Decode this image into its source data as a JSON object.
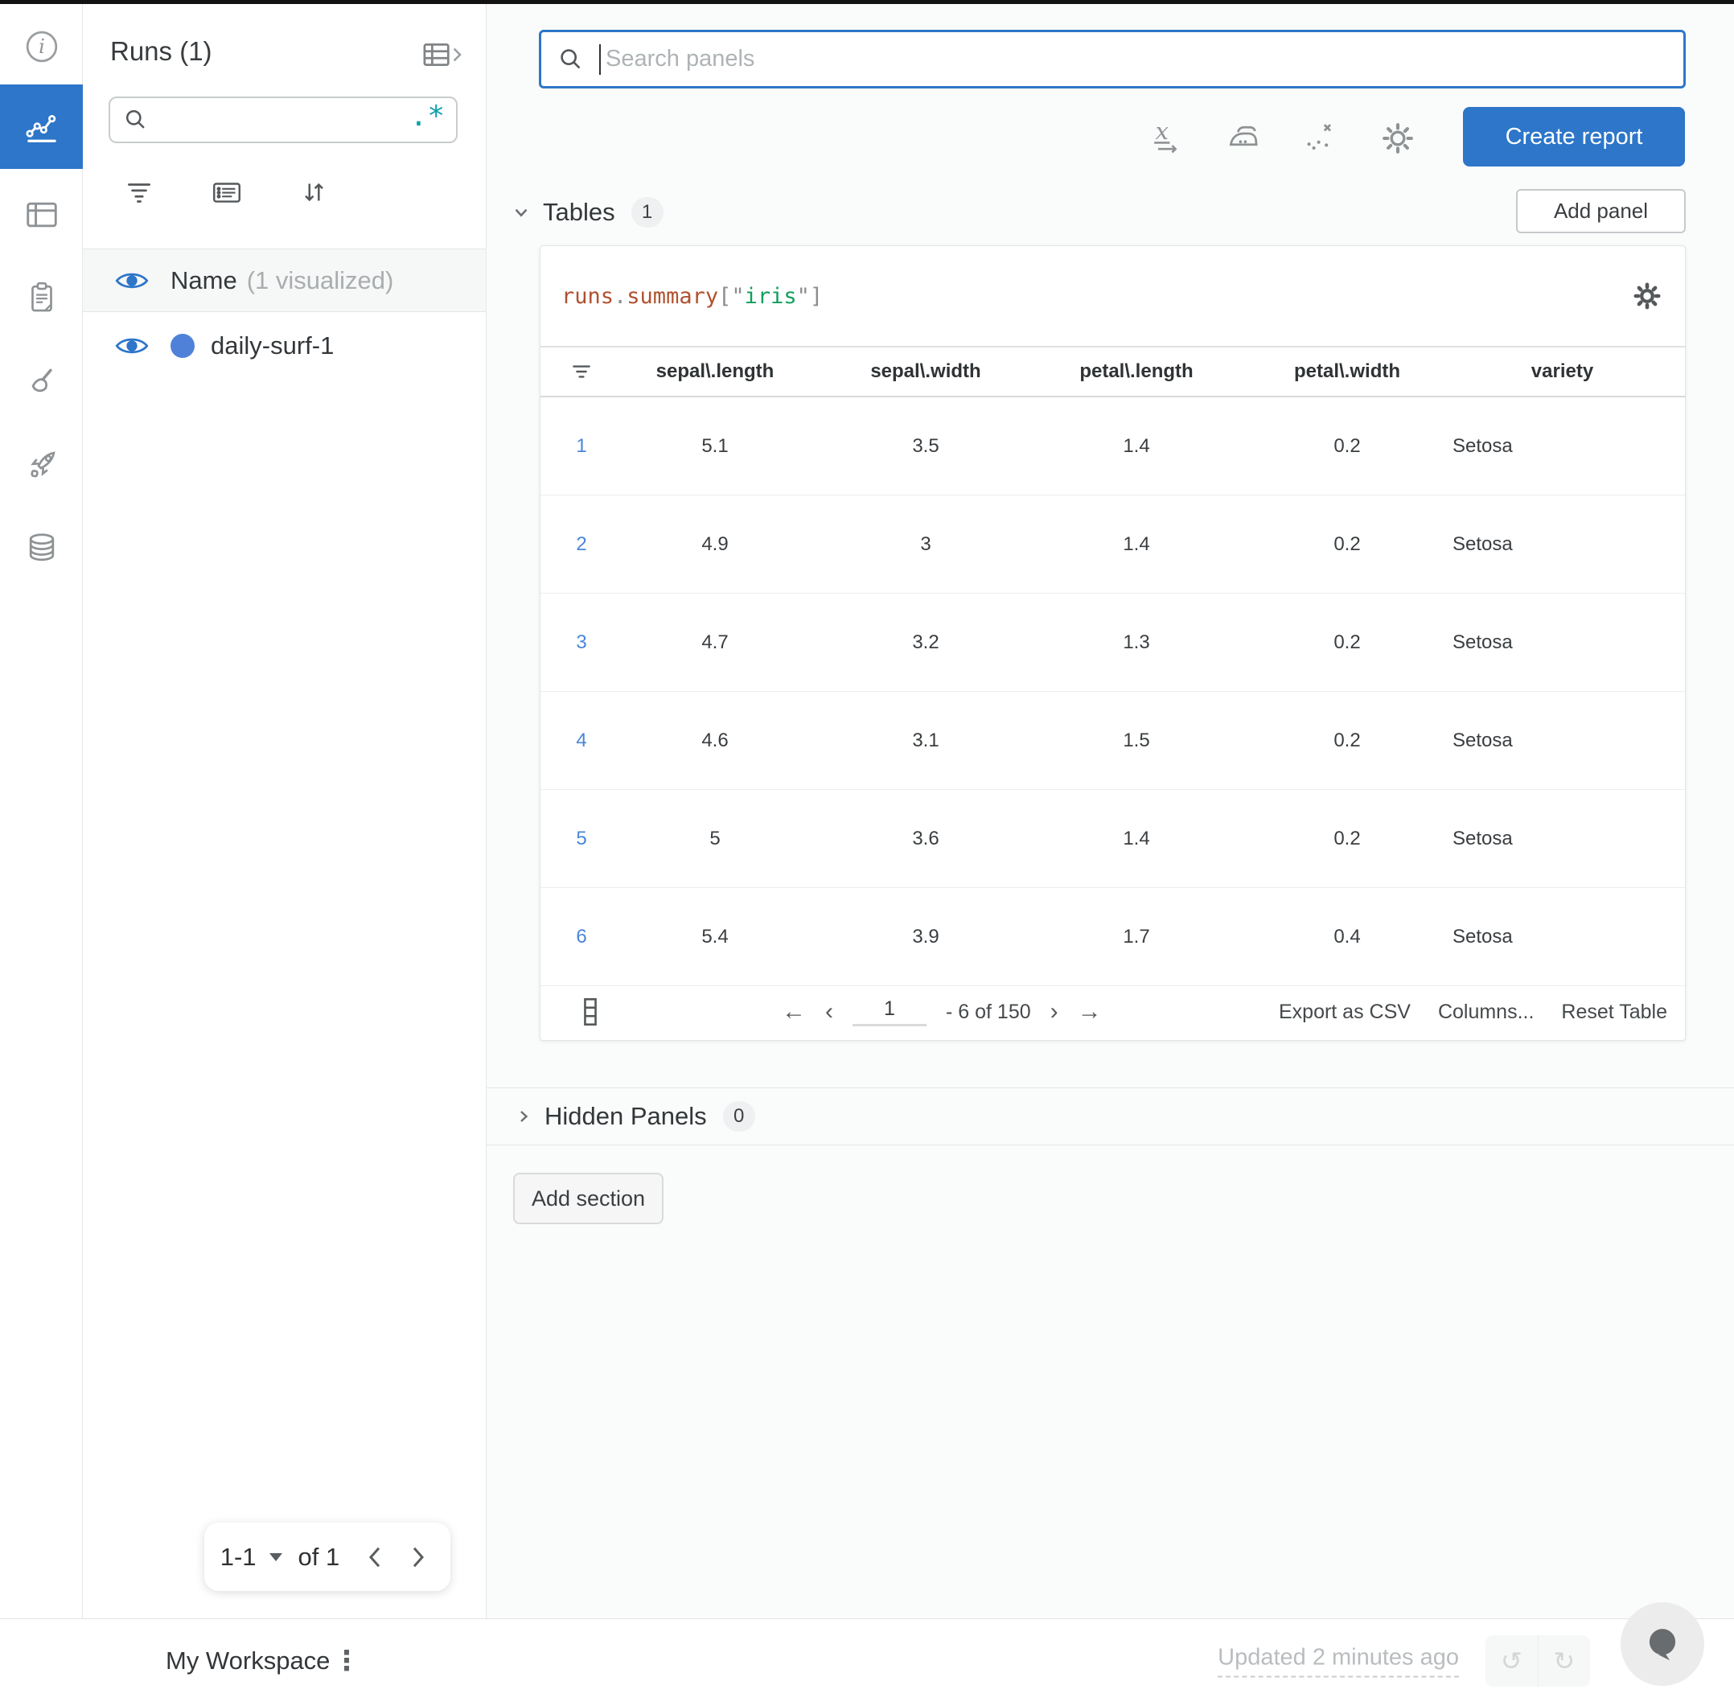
{
  "colors": {
    "primary_blue": "#2d76c9",
    "run_dot_blue": "#4f81d9",
    "index_link_blue": "#4a86d8",
    "regex_teal": "#0ea1ad",
    "code_orange": "#b0512f",
    "code_green": "#129e5c",
    "code_punctuation_gray": "#8c8c8c"
  },
  "nav_rail": {
    "icons": [
      "info",
      "charts",
      "panels",
      "notes",
      "sweeps",
      "launch",
      "artifacts"
    ],
    "active": "charts"
  },
  "runs_panel": {
    "title": "Runs (1)",
    "search": {
      "value": "",
      "regex_glyph": ".*"
    },
    "header_row": {
      "label": "Name",
      "annotation": "(1 visualized)"
    },
    "runs": [
      {
        "name": "daily-surf-1"
      }
    ],
    "pagination": {
      "range": "1-1",
      "of": "of 1"
    }
  },
  "topbar": {
    "search_placeholder": "Search panels",
    "create_report": "Create report"
  },
  "sections": {
    "tables": {
      "label": "Tables",
      "count": "1",
      "add_panel": "Add panel"
    },
    "hidden": {
      "label": "Hidden Panels",
      "count": "0"
    },
    "add_section": "Add section"
  },
  "panel": {
    "title_tokens": [
      {
        "t": "runs"
      },
      {
        "t": "."
      },
      {
        "t": "summary"
      },
      {
        "t": "[\""
      },
      {
        "t": "iris"
      },
      {
        "t": "\"]"
      }
    ],
    "table": {
      "columns": [
        "sepal\\.length",
        "sepal\\.width",
        "petal\\.length",
        "petal\\.width",
        "variety"
      ],
      "rows": [
        {
          "index": "1",
          "cells": [
            "5.1",
            "3.5",
            "1.4",
            "0.2",
            "Setosa"
          ]
        },
        {
          "index": "2",
          "cells": [
            "4.9",
            "3",
            "1.4",
            "0.2",
            "Setosa"
          ]
        },
        {
          "index": "3",
          "cells": [
            "4.7",
            "3.2",
            "1.3",
            "0.2",
            "Setosa"
          ]
        },
        {
          "index": "4",
          "cells": [
            "4.6",
            "3.1",
            "1.5",
            "0.2",
            "Setosa"
          ]
        },
        {
          "index": "5",
          "cells": [
            "5",
            "3.6",
            "1.4",
            "0.2",
            "Setosa"
          ]
        },
        {
          "index": "6",
          "cells": [
            "5.4",
            "3.9",
            "1.7",
            "0.4",
            "Setosa"
          ]
        }
      ],
      "footer": {
        "page": "1",
        "range": "- 6 of 150",
        "first": "←",
        "prev": "‹",
        "next": "›",
        "last": "→",
        "export": "Export as CSV",
        "columns": "Columns...",
        "reset": "Reset Table"
      }
    }
  },
  "statusbar": {
    "workspace": "My Workspace",
    "kebab": "⋮",
    "updated": "Updated 2 minutes ago",
    "undo": "↺",
    "redo": "↻"
  }
}
